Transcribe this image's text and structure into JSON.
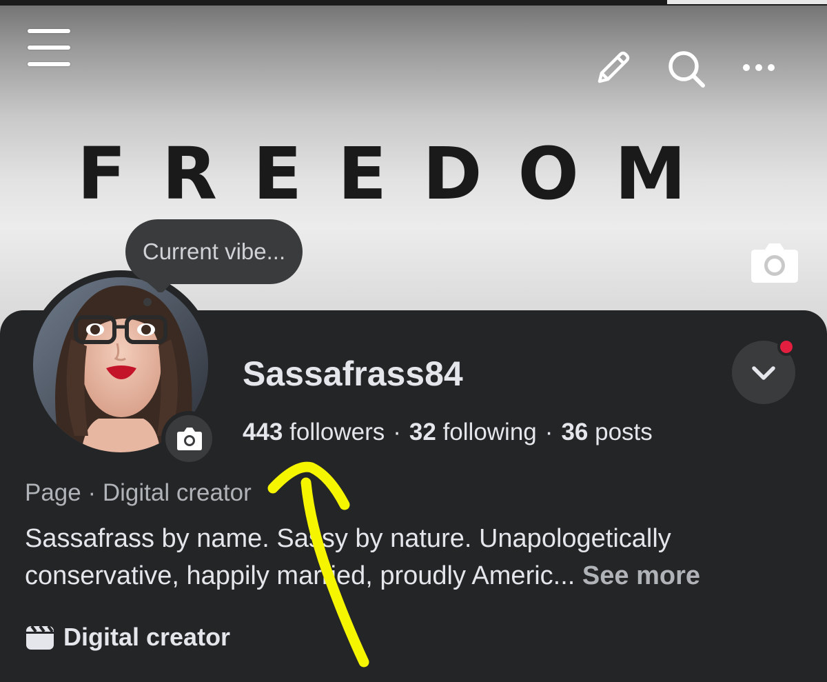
{
  "cover": {
    "headline": "FREEDOM"
  },
  "toolbar": {
    "icons": [
      "hamburger-menu-icon",
      "pencil-icon",
      "search-icon",
      "more-icon"
    ]
  },
  "vibe_bubble": {
    "text": "Current vibe..."
  },
  "profile": {
    "name": "Sassafrass84",
    "followers_count": "443",
    "followers_label": "followers",
    "following_count": "32",
    "following_label": "following",
    "posts_count": "36",
    "posts_label": "posts",
    "separator": "·",
    "category": "Page · Digital creator",
    "bio": "Sassafrass by name. Sassy by nature. Unapologetically conservative, happily married, proudly Americ...",
    "see_more": "See more",
    "detail_label": "Digital creator"
  },
  "colors": {
    "panel_bg": "#242526",
    "button_bg": "#3a3b3c",
    "primary_text": "#e4e6eb",
    "secondary_text": "#b0b3b8",
    "notification_red": "#e41e3f",
    "annotation_yellow": "#f5f500"
  }
}
